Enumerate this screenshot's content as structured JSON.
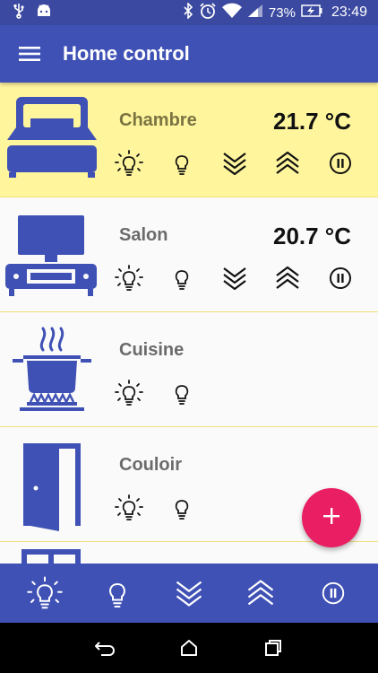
{
  "status_bar": {
    "battery": "73%",
    "time": "23:49"
  },
  "app_bar": {
    "title": "Home control",
    "menu_icon": "hamburger-menu-icon"
  },
  "rooms": [
    {
      "name": "Chambre",
      "temperature": "21.7 °C",
      "icon": "bed-icon",
      "active": true,
      "controls": [
        "lights-on-icon",
        "light-off-icon",
        "shutter-down-icon",
        "shutter-up-icon",
        "pause-icon"
      ]
    },
    {
      "name": "Salon",
      "temperature": "20.7 °C",
      "icon": "tv-unit-icon",
      "active": false,
      "controls": [
        "lights-on-icon",
        "light-off-icon",
        "shutter-down-icon",
        "shutter-up-icon",
        "pause-icon"
      ]
    },
    {
      "name": "Cuisine",
      "temperature": "",
      "icon": "cooking-pot-icon",
      "active": false,
      "controls": [
        "lights-on-icon",
        "light-off-icon"
      ]
    },
    {
      "name": "Couloir",
      "temperature": "",
      "icon": "door-icon",
      "active": false,
      "controls": [
        "lights-on-icon",
        "light-off-icon"
      ]
    }
  ],
  "bottom_bar": {
    "actions": [
      "all-lights-on-icon",
      "all-lights-off-icon",
      "all-shutters-down-icon",
      "all-shutters-up-icon",
      "pause-all-icon"
    ]
  },
  "fab": {
    "icon": "plus-icon"
  },
  "nav_bar": {
    "buttons": [
      "back-icon",
      "home-icon",
      "recent-apps-icon"
    ]
  },
  "colors": {
    "primary": "#3f51b5",
    "status_bar": "#3b4aa0",
    "active_row": "#fff59d",
    "fab": "#e91e63",
    "room_icon": "#3f51b5"
  }
}
